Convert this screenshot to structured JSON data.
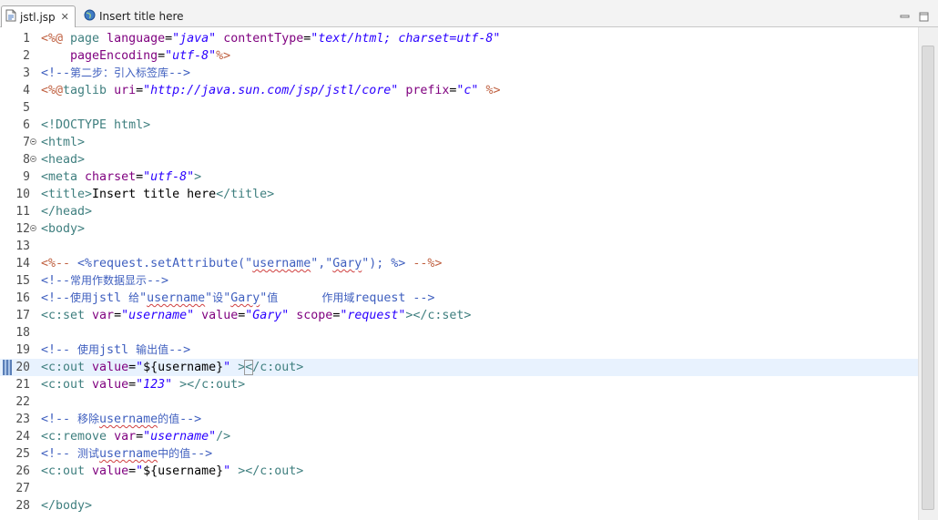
{
  "tabs": [
    {
      "label": "jstl.jsp",
      "active": true,
      "icon": "jsp-file-icon"
    },
    {
      "label": "Insert title here",
      "active": false,
      "icon": "globe-icon"
    }
  ],
  "current_line": 20,
  "lines": [
    {
      "n": "1"
    },
    {
      "n": "2"
    },
    {
      "n": "3"
    },
    {
      "n": "4"
    },
    {
      "n": "5"
    },
    {
      "n": "6"
    },
    {
      "n": "7"
    },
    {
      "n": "8"
    },
    {
      "n": "9"
    },
    {
      "n": "10"
    },
    {
      "n": "11"
    },
    {
      "n": "12"
    },
    {
      "n": "13"
    },
    {
      "n": "14"
    },
    {
      "n": "15"
    },
    {
      "n": "16"
    },
    {
      "n": "17"
    },
    {
      "n": "18"
    },
    {
      "n": "19"
    },
    {
      "n": "20"
    },
    {
      "n": "21"
    },
    {
      "n": "22"
    },
    {
      "n": "23"
    },
    {
      "n": "24"
    },
    {
      "n": "25"
    },
    {
      "n": "26"
    },
    {
      "n": "27"
    },
    {
      "n": "28"
    }
  ],
  "code": {
    "l1": {
      "d1": "<%@",
      "kw": " page ",
      "a1": "language",
      "eq1": "=",
      "v1": "\"java\"",
      "sp": " ",
      "a2": "contentType",
      "eq2": "=",
      "v2": "\"text/html; charset=utf-8\""
    },
    "l2": {
      "ind": "    ",
      "a1": "pageEncoding",
      "eq1": "=",
      "v1": "\"utf-8\"",
      "d2": "%>"
    },
    "l3": {
      "c1": "<!--",
      "cjk": "第二步：引入标签库",
      "c2": "-->"
    },
    "l4": {
      "d1": "<%@",
      "kw": "taglib ",
      "a1": "uri",
      "eq1": "=",
      "v1": "\"http://java.sun.com/jsp/jstl/core\"",
      "sp": " ",
      "a2": "prefix",
      "eq2": "=",
      "v2": "\"c\"",
      "d2": " %>"
    },
    "l5": {
      "t": ""
    },
    "l6": {
      "k": "<!DOCTYPE html>"
    },
    "l7": {
      "k": "<html>"
    },
    "l8": {
      "k": "<head>"
    },
    "l9": {
      "k1": "<meta ",
      "a1": "charset",
      "eq1": "=",
      "v1": "\"utf-8\"",
      "k2": ">"
    },
    "l10": {
      "k1": "<title>",
      "t": "Insert title here",
      "k2": "</title>"
    },
    "l11": {
      "k": "</head>"
    },
    "l12": {
      "k": "<body>"
    },
    "l13": {
      "t": ""
    },
    "l14": {
      "d1": "<%--",
      "t1": " <%request.setAttribute(\"",
      "sq1": "username",
      "t2": "\",\"",
      "sq2": "Gary",
      "t3": "\"); %> ",
      "d2": "--%>"
    },
    "l15": {
      "c1": "<!--",
      "cjk": "常用作数据显示",
      "c2": "-->"
    },
    "l16": {
      "c1": "<!--",
      "cjk1": "使用",
      "m1": "jstl ",
      "cjk2": "给",
      "m2": "\"",
      "sq1": "username",
      "m3": "\"",
      "cjk3": "设",
      "m4": "\"",
      "sq2": "Gary",
      "m5": "\"",
      "cjk4": "值",
      "m6": "      ",
      "cjk5": "作用域",
      "m7": "request ",
      "c2": "-->"
    },
    "l17": {
      "k1": "<c:set ",
      "a1": "var",
      "eq1": "=",
      "v1": "\"username\"",
      "sp1": " ",
      "a2": "value",
      "eq2": "=",
      "v2": "\"Gary\"",
      "sp2": " ",
      "a3": "scope",
      "eq3": "=",
      "v3": "\"request\"",
      "k2": "></c:set>"
    },
    "l18": {
      "t": ""
    },
    "l19": {
      "c1": "<!-- ",
      "cjk1": "使用",
      "m1": "jstl ",
      "cjk2": "输出值",
      "c2": "-->"
    },
    "l20": {
      "k1": "<c:out ",
      "a1": "value",
      "eq1": "=",
      "v1a": "\"",
      "t": "${username}",
      "v1b": "\"",
      "k2": " >",
      "cursor": "<",
      "k3": "/c:out>"
    },
    "l21": {
      "k1": "<c:out ",
      "a1": "value",
      "eq1": "=",
      "v1": "\"123\"",
      "k2": " ></c:out>"
    },
    "l22": {
      "t": ""
    },
    "l23": {
      "c1": "<!-- ",
      "cjk1": "移除",
      "sq": "username",
      "cjk2": "的值",
      "c2": "-->"
    },
    "l24": {
      "k1": "<c:remove ",
      "a1": "var",
      "eq1": "=",
      "v1": "\"username\"",
      "k2": "/>"
    },
    "l25": {
      "c1": "<!-- ",
      "cjk1": "测试",
      "sq": "username",
      "cjk2": "中的值",
      "c2": "-->"
    },
    "l26": {
      "k1": "<c:out ",
      "a1": "value",
      "eq1": "=",
      "v1a": "\"",
      "t": "${username}",
      "v1b": "\"",
      "k2": " ></c:out>"
    },
    "l27": {
      "t": ""
    },
    "l28": {
      "k": "</body>"
    }
  },
  "colors": {
    "jsp_delimiter": "#bf5f3f",
    "tag": "#3f7f7f",
    "attribute": "#7f007f",
    "string": "#2a00ff",
    "comment": "#3f5fbf",
    "current_line_bg": "#e8f2fe"
  }
}
